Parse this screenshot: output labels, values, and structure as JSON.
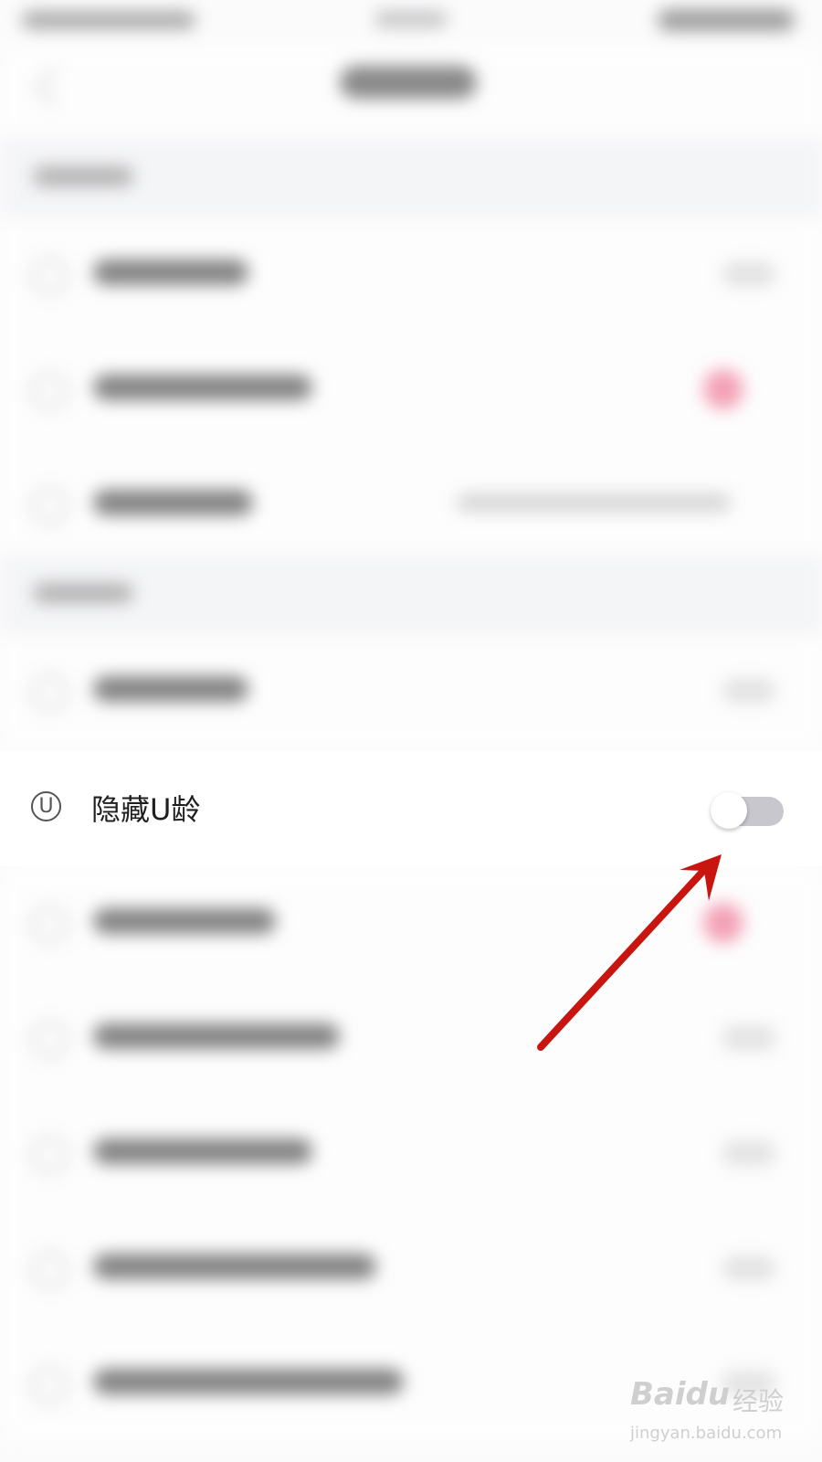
{
  "focused_setting": {
    "icon": "U",
    "label": "隐藏U龄",
    "toggle_on": false
  },
  "watermark": {
    "brand": "Baidu",
    "brand_cn": "经验",
    "url": "jingyan.baidu.com"
  },
  "colors": {
    "arrow": "#c8150f",
    "toggle_track_off": "#c8c7cd",
    "accent_pink": "#f06a8c"
  }
}
